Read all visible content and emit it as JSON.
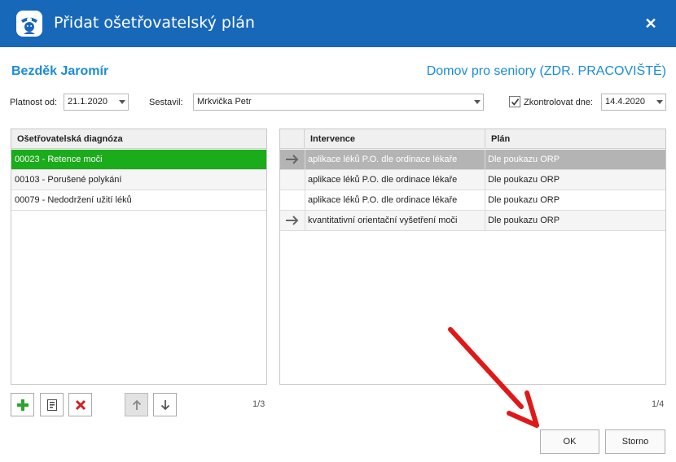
{
  "window": {
    "title": "Přidat ošetřovatelský plán",
    "close_label": "✕"
  },
  "patient": {
    "name": "Bezděk Jaromír"
  },
  "ward": "Domov pro seniory (ZDR. PRACOVIŠTĚ)",
  "form": {
    "valid_from_label": "Platnost od:",
    "valid_from_value": "21.1.2020",
    "author_label": "Sestavil:",
    "author_value": "Mrkvička Petr",
    "check_label": "Zkontrolovat dne:",
    "check_checked": true,
    "check_date": "14.4.2020"
  },
  "diagnoses": {
    "header": "Ošetřovatelská diagnóza",
    "rows": [
      {
        "label": "00023 - Retence moči",
        "selected": true
      },
      {
        "label": "00103 - Porušené polykání",
        "selected": false
      },
      {
        "label": "00079 - Nedodržení užití léků",
        "selected": false
      }
    ],
    "count": "1/3"
  },
  "interventions": {
    "header_intervention": "Intervence",
    "header_plan": "Plán",
    "rows": [
      {
        "arrow": true,
        "intervention": "aplikace léků P.O. dle ordinace lékaře",
        "plan": "Dle poukazu ORP",
        "selected": true
      },
      {
        "arrow": false,
        "intervention": "aplikace léků P.O. dle ordinace lékaře",
        "plan": "Dle poukazu ORP",
        "selected": false
      },
      {
        "arrow": false,
        "intervention": "aplikace léků P.O. dle ordinace lékaře",
        "plan": "Dle poukazu ORP",
        "selected": false
      },
      {
        "arrow": true,
        "intervention": "kvantitativní orientační vyšetření moči",
        "plan": "Dle poukazu ORP",
        "selected": false
      }
    ],
    "count": "1/4"
  },
  "toolbar": {
    "add": "plus-icon",
    "edit": "document-edit-icon",
    "delete": "delete-x-icon",
    "up": "arrow-up-icon",
    "down": "arrow-down-icon"
  },
  "buttons": {
    "ok": "OK",
    "cancel": "Storno"
  },
  "colors": {
    "titlebar": "#1868ba",
    "accent_text": "#1a8cd8",
    "selected_diagnosis": "#1aac1a",
    "selected_intervention": "#b4b4b4",
    "annotation_arrow": "#e01818"
  }
}
